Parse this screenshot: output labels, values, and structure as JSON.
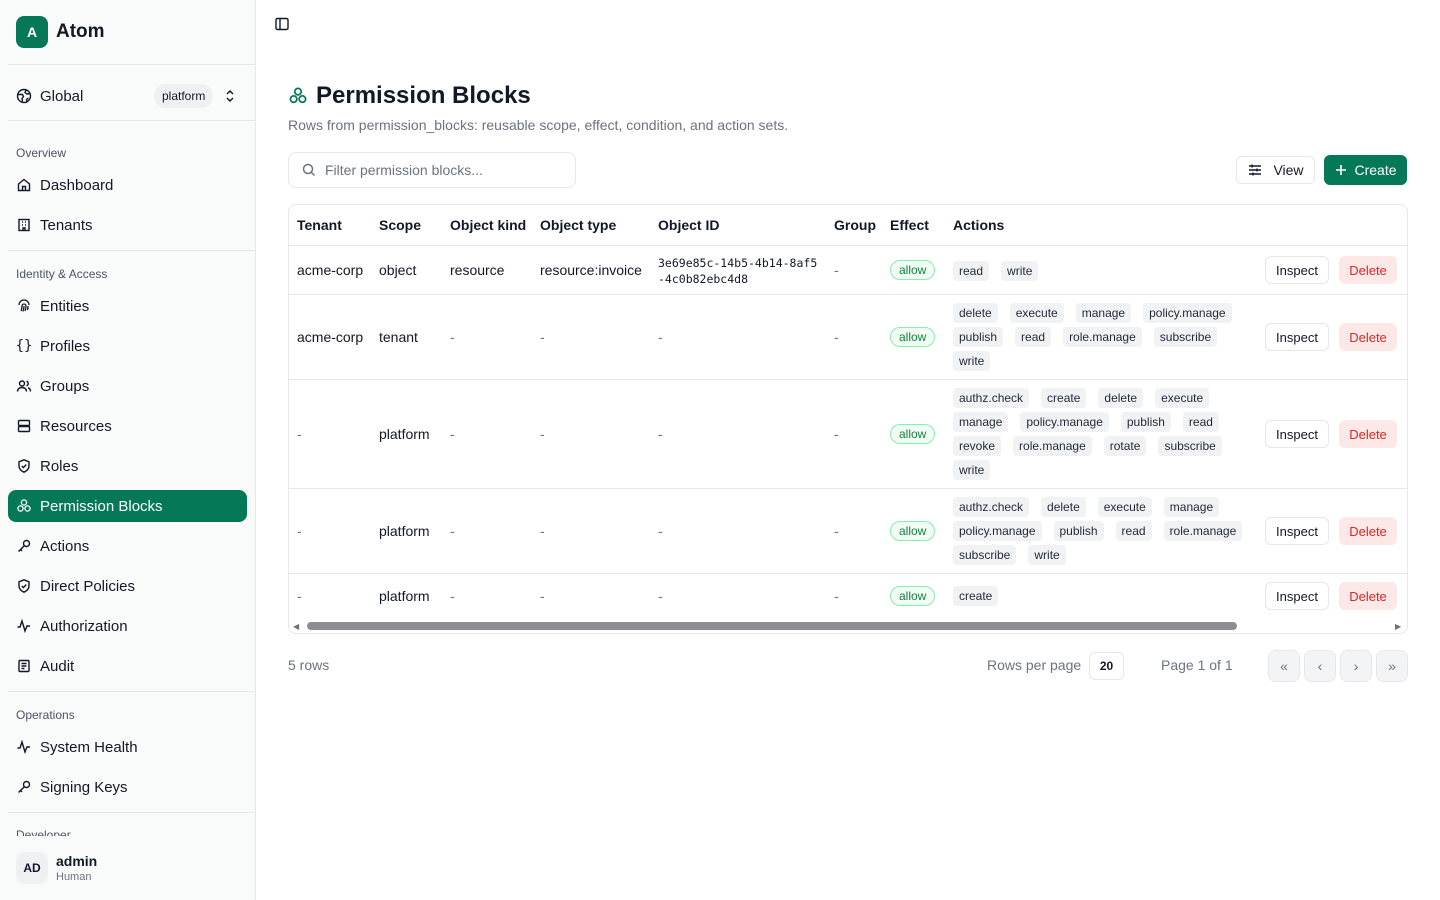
{
  "brand": {
    "logo_letter": "A",
    "name": "Atom"
  },
  "scope": {
    "label": "Global",
    "badge": "platform"
  },
  "sidebar": {
    "sections": [
      {
        "title": "Overview"
      },
      {
        "title": "Identity & Access"
      },
      {
        "title": "Operations"
      },
      {
        "title": "Developer"
      }
    ],
    "items": [
      {
        "label": "Dashboard",
        "icon": "home-icon"
      },
      {
        "label": "Tenants",
        "icon": "building-icon"
      },
      {
        "label": "Entities",
        "icon": "fingerprint-icon"
      },
      {
        "label": "Profiles",
        "icon": "braces-icon"
      },
      {
        "label": "Groups",
        "icon": "users-icon"
      },
      {
        "label": "Resources",
        "icon": "database-icon"
      },
      {
        "label": "Roles",
        "icon": "shield-icon"
      },
      {
        "label": "Permission Blocks",
        "icon": "blocks-icon",
        "active": true
      },
      {
        "label": "Actions",
        "icon": "key-icon"
      },
      {
        "label": "Direct Policies",
        "icon": "shield-icon"
      },
      {
        "label": "Authorization",
        "icon": "activity-icon"
      },
      {
        "label": "Audit",
        "icon": "list-icon"
      },
      {
        "label": "System Health",
        "icon": "activity-icon"
      },
      {
        "label": "Signing Keys",
        "icon": "key-icon"
      }
    ]
  },
  "user": {
    "initials": "AD",
    "name": "admin",
    "role": "Human"
  },
  "page": {
    "title": "Permission Blocks",
    "subtitle": "Rows from permission_blocks: reusable scope, effect, condition, and action sets."
  },
  "filter": {
    "placeholder": "Filter permission blocks..."
  },
  "toolbar": {
    "view_label": "View",
    "create_label": "Create"
  },
  "table": {
    "columns": [
      "Tenant",
      "Scope",
      "Object kind",
      "Object type",
      "Object ID",
      "Group",
      "Effect",
      "Actions"
    ],
    "inspect_label": "Inspect",
    "delete_label": "Delete",
    "rows": [
      {
        "tenant": "acme-corp",
        "scope": "object",
        "object_kind": "resource",
        "object_type": "resource:invoice",
        "object_id": "3e69e85c-14b5-4b14-8af5-4c0b82ebc4d8",
        "group": "-",
        "effect": "allow",
        "actions": [
          "read",
          "write"
        ]
      },
      {
        "tenant": "acme-corp",
        "scope": "tenant",
        "object_kind": "-",
        "object_type": "-",
        "object_id": "-",
        "group": "-",
        "effect": "allow",
        "actions": [
          "delete",
          "execute",
          "manage",
          "policy.manage",
          "publish",
          "read",
          "role.manage",
          "subscribe",
          "write"
        ]
      },
      {
        "tenant": "-",
        "scope": "platform",
        "object_kind": "-",
        "object_type": "-",
        "object_id": "-",
        "group": "-",
        "effect": "allow",
        "actions": [
          "authz.check",
          "create",
          "delete",
          "execute",
          "manage",
          "policy.manage",
          "publish",
          "read",
          "revoke",
          "role.manage",
          "rotate",
          "subscribe",
          "write"
        ]
      },
      {
        "tenant": "-",
        "scope": "platform",
        "object_kind": "-",
        "object_type": "-",
        "object_id": "-",
        "group": "-",
        "effect": "allow",
        "actions": [
          "authz.check",
          "delete",
          "execute",
          "manage",
          "policy.manage",
          "publish",
          "read",
          "role.manage",
          "subscribe",
          "write"
        ]
      },
      {
        "tenant": "-",
        "scope": "platform",
        "object_kind": "-",
        "object_type": "-",
        "object_id": "-",
        "group": "-",
        "effect": "allow",
        "actions": [
          "create"
        ]
      }
    ]
  },
  "pagination": {
    "row_count": "5 rows",
    "rows_per_page_label": "Rows per page",
    "rows_per_page": "20",
    "page_info": "Page 1 of 1",
    "first": "«",
    "prev": "‹",
    "next": "›",
    "last": "»"
  },
  "colors": {
    "accent": "#047857",
    "danger": "#dc2626",
    "allow": "#15803d"
  }
}
